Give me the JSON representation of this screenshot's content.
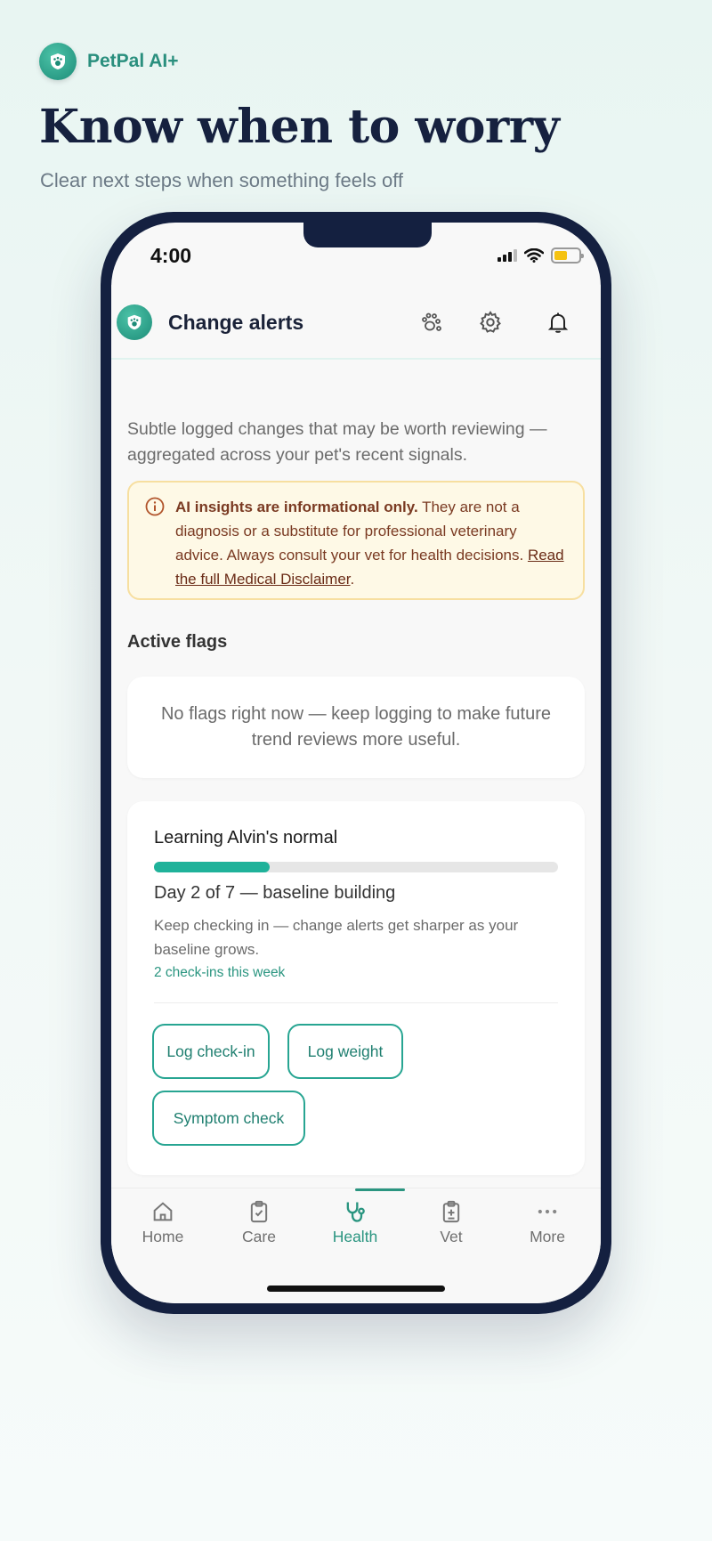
{
  "brand": {
    "name": "PetPal AI+"
  },
  "headline": "Know when to worry",
  "subhead": "Clear next steps when something feels off",
  "status_bar": {
    "time": "4:00"
  },
  "app_header": {
    "title": "Change alerts"
  },
  "intro_text": "Subtle logged changes that may be worth reviewing — aggregated across your pet's recent signals.",
  "disclaimer": {
    "bold": "AI insights are informational only.",
    "text": " They are not a diagnosis or a substitute for professional veterinary advice. Always consult your vet for health decisions. ",
    "link": "Read the full Medical Disclaimer",
    "suffix": "."
  },
  "active_flags": {
    "title": "Active flags",
    "empty_message": "No flags right now — keep logging to make future trend reviews more useful."
  },
  "learning": {
    "title": "Learning Alvin's normal",
    "progress_fraction": 0.2857,
    "day_text": "Day 2 of 7 — baseline building",
    "description": "Keep checking in — change alerts get sharper as your baseline grows.",
    "count_text": "2 check-ins this week",
    "actions": [
      "Log check-in",
      "Log weight",
      "Symptom check"
    ]
  },
  "tabs": [
    {
      "label": "Home",
      "icon": "home-icon"
    },
    {
      "label": "Care",
      "icon": "clipboard-icon"
    },
    {
      "label": "Health",
      "icon": "stethoscope-icon",
      "active": true
    },
    {
      "label": "Vet",
      "icon": "medical-file-icon"
    },
    {
      "label": "More",
      "icon": "more-dots-icon"
    }
  ],
  "colors": {
    "accent": "#2a9580",
    "headline": "#16213f",
    "disclaimer_bg": "#fef9e6",
    "battery": "#f5c211"
  }
}
